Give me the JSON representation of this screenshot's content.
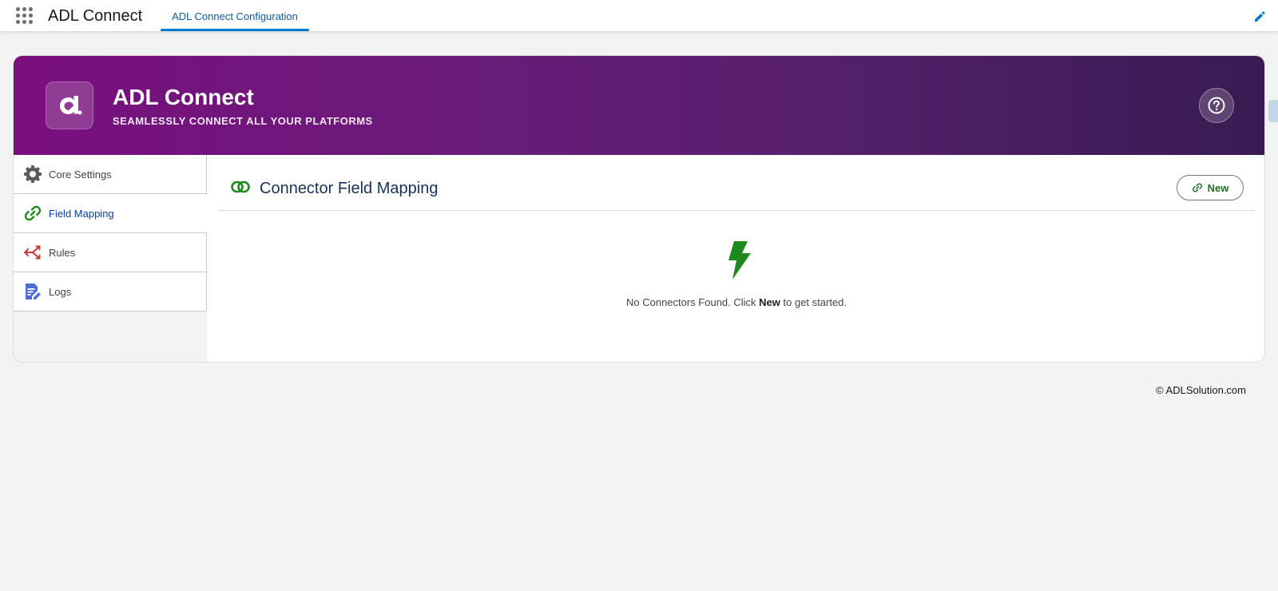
{
  "topbar": {
    "app_name": "ADL Connect",
    "active_tab": "ADL Connect Configuration"
  },
  "banner": {
    "title": "ADL Connect",
    "subtitle": "SEAMLESSLY CONNECT ALL YOUR PLATFORMS",
    "help_icon": "question-circle-icon"
  },
  "sidebar": {
    "items": [
      {
        "label": "Core Settings",
        "icon": "gear-icon",
        "active": false
      },
      {
        "label": "Field Mapping",
        "icon": "link-icon",
        "active": true
      },
      {
        "label": "Rules",
        "icon": "flow-arrows-icon",
        "active": false
      },
      {
        "label": "Logs",
        "icon": "document-edit-icon",
        "active": false
      }
    ]
  },
  "main": {
    "title": "Connector Field Mapping",
    "new_button": "New",
    "empty": {
      "prefix": "No Connectors Found. Click ",
      "bold": "New",
      "suffix": " to get started."
    }
  },
  "footer": {
    "text": "© ADLSolution.com"
  },
  "colors": {
    "brand_purple": "#7a0f7e",
    "brand_dark": "#391b52",
    "accent_green": "#1d8a1d",
    "link_blue": "#0b5cab"
  }
}
